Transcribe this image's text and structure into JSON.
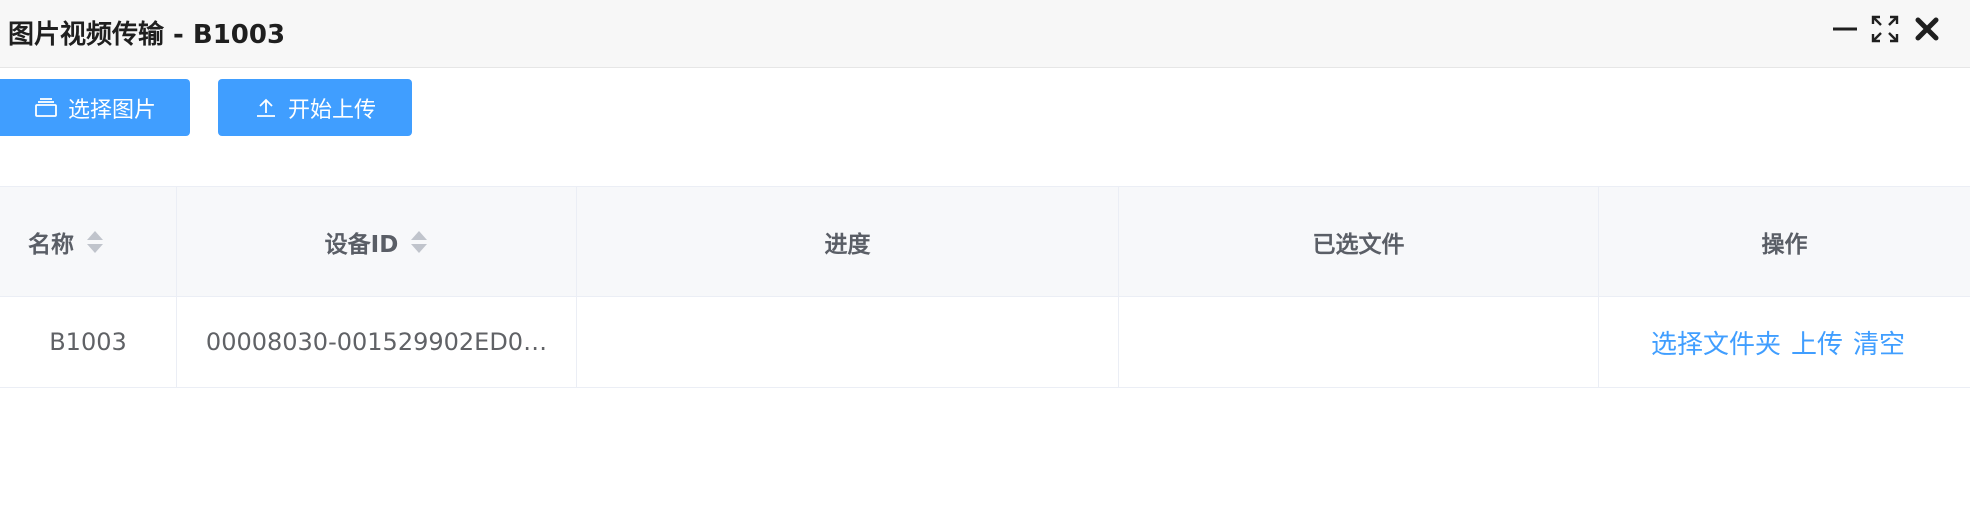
{
  "window": {
    "title": "图片视频传输 - B1003",
    "controls": [
      "minimize-icon",
      "fullscreen-icon",
      "close-icon"
    ]
  },
  "toolbar": {
    "select_images_label": "选择图片",
    "start_upload_label": "开始上传"
  },
  "table": {
    "columns": [
      {
        "label": "名称",
        "sortable": true
      },
      {
        "label": "设备ID",
        "sortable": true
      },
      {
        "label": "进度",
        "sortable": false
      },
      {
        "label": "已选文件",
        "sortable": false
      },
      {
        "label": "操作",
        "sortable": false
      }
    ],
    "rows": [
      {
        "name": "B1003",
        "device_id": "00008030-001529902ED0…",
        "progress": "",
        "selected_files": "",
        "actions": {
          "select_folder": "选择文件夹",
          "upload": "上传",
          "clear": "清空"
        }
      }
    ]
  },
  "colors": {
    "primary": "#409eff",
    "header_bg": "#f7f8fa",
    "titlebar_bg": "#f7f7f7",
    "border": "#ebeef5"
  }
}
